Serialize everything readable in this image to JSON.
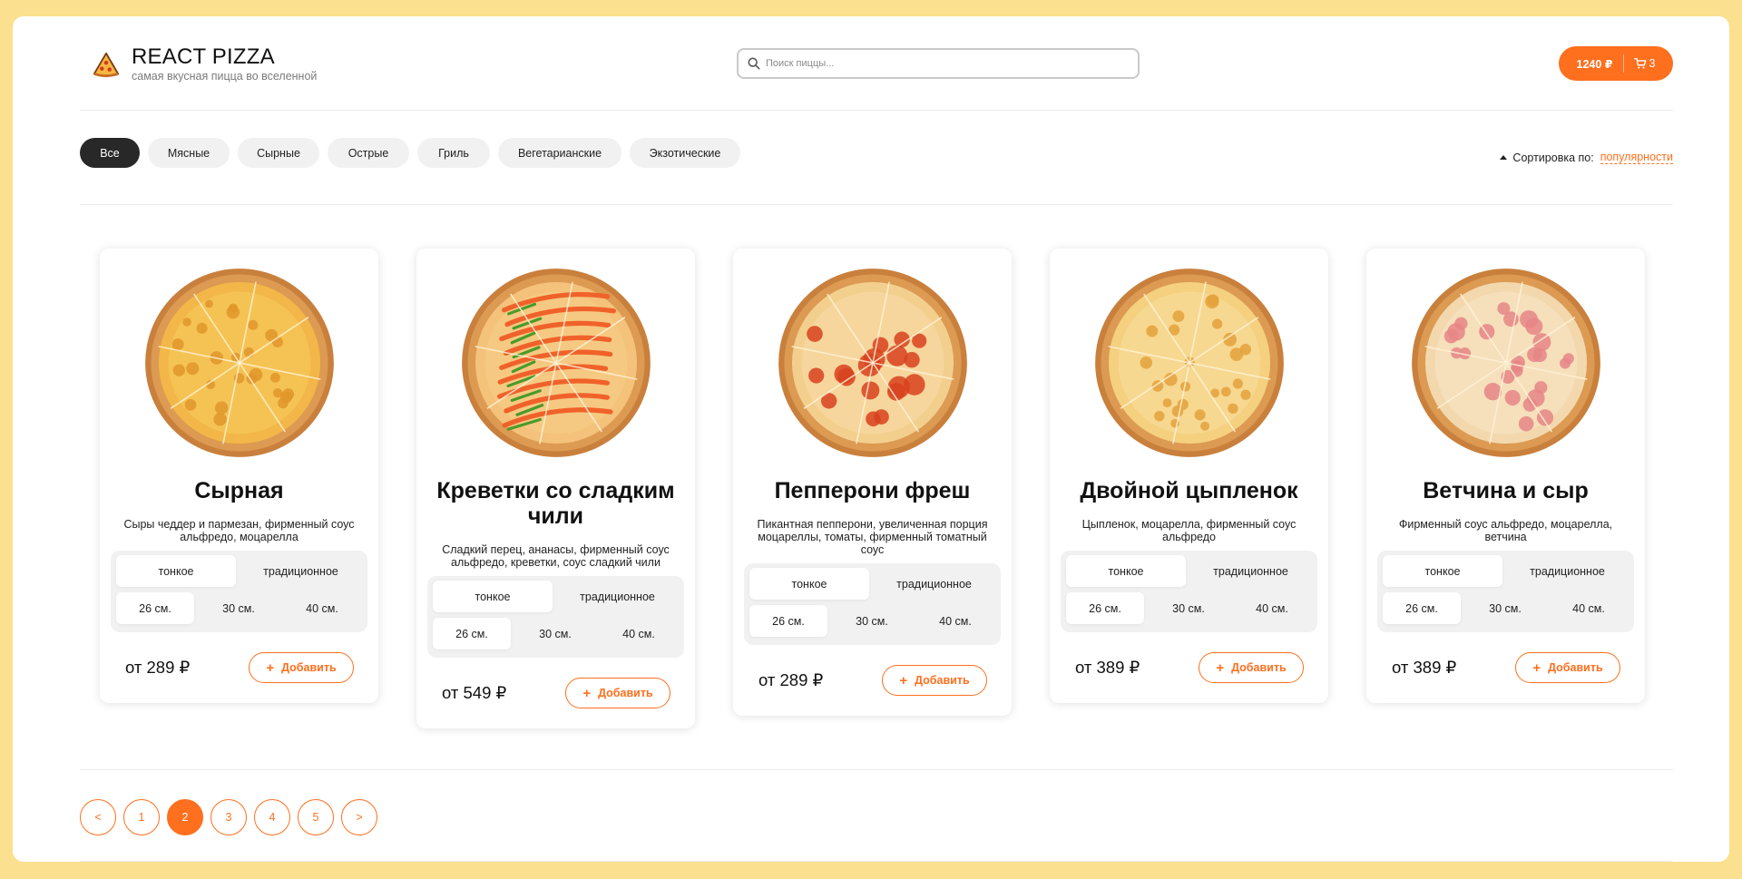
{
  "header": {
    "logo_title": "REACT PIZZA",
    "logo_subtitle": "самая вкусная пицца во вселенной",
    "search_placeholder": "Поиск пиццы...",
    "cart_price": "1240 ₽",
    "cart_count": "3"
  },
  "categories": [
    "Все",
    "Мясные",
    "Сырные",
    "Острые",
    "Гриль",
    "Вегетарианские",
    "Экзотические"
  ],
  "active_category": "Все",
  "sort": {
    "label": "Сортировка по:",
    "value": "популярности"
  },
  "pizzas": [
    {
      "name": "Сырная",
      "description": "Сыры чеддер и пармезан, фирменный соус альфредо, моцарелла",
      "types": [
        "тонкое",
        "традиционное"
      ],
      "sizes": [
        "26 см.",
        "30 см.",
        "40 см."
      ],
      "price": "от 289 ₽",
      "add_label": "Добавить",
      "style": "cheese"
    },
    {
      "name": "Креветки со сладким чили",
      "description": "Сладкий перец, ананасы, фирменный соус альфредо, креветки, соус сладкий чили",
      "types": [
        "тонкое",
        "традиционное"
      ],
      "sizes": [
        "26 см.",
        "30 см.",
        "40 см."
      ],
      "price": "от 549 ₽",
      "add_label": "Добавить",
      "style": "shrimp"
    },
    {
      "name": "Пепперони фреш",
      "description": "Пикантная пепперони, увеличенная порция моцареллы, томаты, фирменный томатный соус",
      "types": [
        "тонкое",
        "традиционное"
      ],
      "sizes": [
        "26 см.",
        "30 см.",
        "40 см."
      ],
      "price": "от 289 ₽",
      "add_label": "Добавить",
      "style": "pepperoni"
    },
    {
      "name": "Двойной цыпленок",
      "description": "Цыпленок, моцарелла, фирменный соус альфредо",
      "types": [
        "тонкое",
        "традиционное"
      ],
      "sizes": [
        "26 см.",
        "30 см.",
        "40 см."
      ],
      "price": "от 389 ₽",
      "add_label": "Добавить",
      "style": "chicken"
    },
    {
      "name": "Ветчина и сыр",
      "description": "Фирменный соус альфредо, моцарелла, ветчина",
      "types": [
        "тонкое",
        "традиционное"
      ],
      "sizes": [
        "26 см.",
        "30 см.",
        "40 см."
      ],
      "price": "от 389 ₽",
      "add_label": "Добавить",
      "style": "ham"
    }
  ],
  "pagination": {
    "prev": "<",
    "next": ">",
    "pages": [
      "1",
      "2",
      "3",
      "4",
      "5"
    ],
    "current": "2"
  },
  "colors": {
    "accent": "#fe6f1e",
    "background": "#fbe08f",
    "dark": "#282828"
  }
}
